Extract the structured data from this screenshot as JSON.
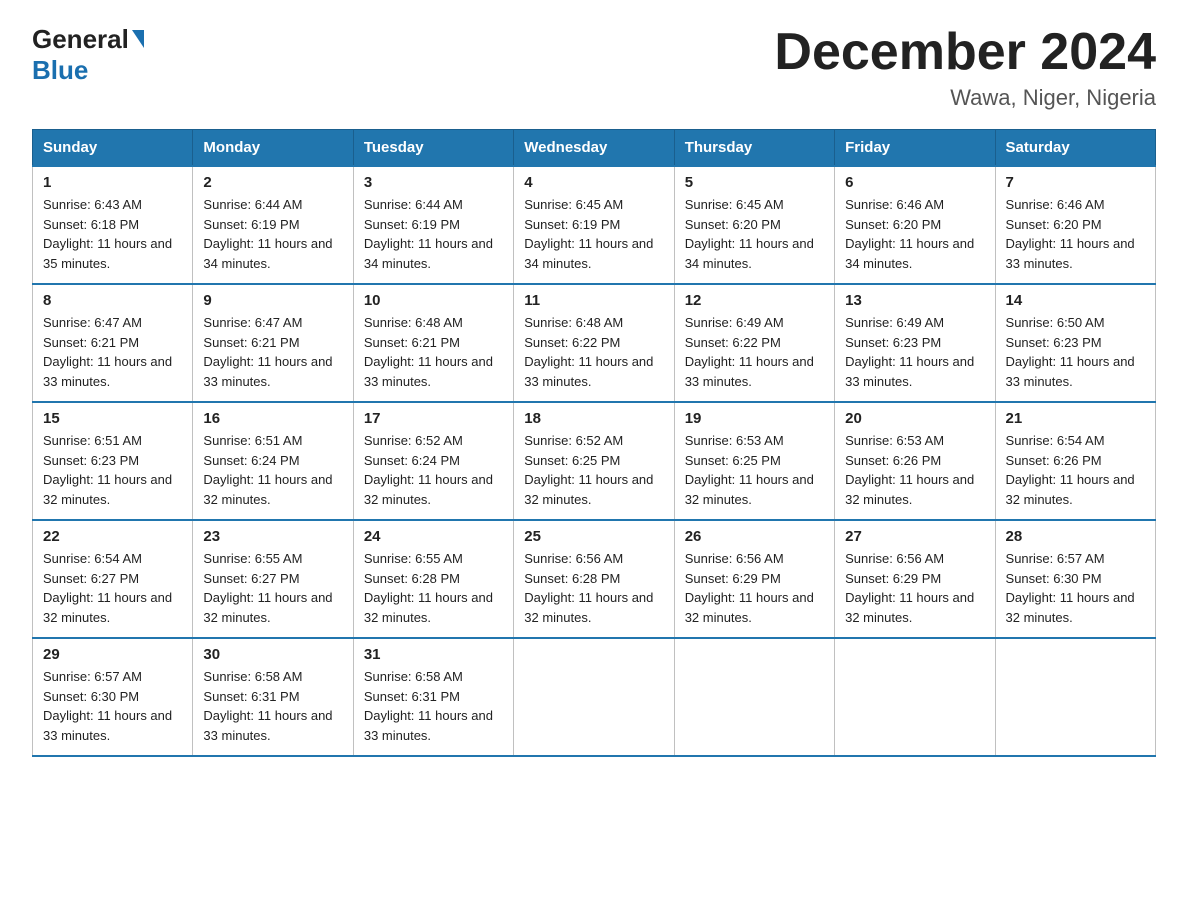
{
  "logo": {
    "general": "General",
    "blue": "Blue"
  },
  "header": {
    "title": "December 2024",
    "subtitle": "Wawa, Niger, Nigeria"
  },
  "days_of_week": [
    "Sunday",
    "Monday",
    "Tuesday",
    "Wednesday",
    "Thursday",
    "Friday",
    "Saturday"
  ],
  "weeks": [
    [
      {
        "day": "1",
        "sunrise": "6:43 AM",
        "sunset": "6:18 PM",
        "daylight": "11 hours and 35 minutes."
      },
      {
        "day": "2",
        "sunrise": "6:44 AM",
        "sunset": "6:19 PM",
        "daylight": "11 hours and 34 minutes."
      },
      {
        "day": "3",
        "sunrise": "6:44 AM",
        "sunset": "6:19 PM",
        "daylight": "11 hours and 34 minutes."
      },
      {
        "day": "4",
        "sunrise": "6:45 AM",
        "sunset": "6:19 PM",
        "daylight": "11 hours and 34 minutes."
      },
      {
        "day": "5",
        "sunrise": "6:45 AM",
        "sunset": "6:20 PM",
        "daylight": "11 hours and 34 minutes."
      },
      {
        "day": "6",
        "sunrise": "6:46 AM",
        "sunset": "6:20 PM",
        "daylight": "11 hours and 34 minutes."
      },
      {
        "day": "7",
        "sunrise": "6:46 AM",
        "sunset": "6:20 PM",
        "daylight": "11 hours and 33 minutes."
      }
    ],
    [
      {
        "day": "8",
        "sunrise": "6:47 AM",
        "sunset": "6:21 PM",
        "daylight": "11 hours and 33 minutes."
      },
      {
        "day": "9",
        "sunrise": "6:47 AM",
        "sunset": "6:21 PM",
        "daylight": "11 hours and 33 minutes."
      },
      {
        "day": "10",
        "sunrise": "6:48 AM",
        "sunset": "6:21 PM",
        "daylight": "11 hours and 33 minutes."
      },
      {
        "day": "11",
        "sunrise": "6:48 AM",
        "sunset": "6:22 PM",
        "daylight": "11 hours and 33 minutes."
      },
      {
        "day": "12",
        "sunrise": "6:49 AM",
        "sunset": "6:22 PM",
        "daylight": "11 hours and 33 minutes."
      },
      {
        "day": "13",
        "sunrise": "6:49 AM",
        "sunset": "6:23 PM",
        "daylight": "11 hours and 33 minutes."
      },
      {
        "day": "14",
        "sunrise": "6:50 AM",
        "sunset": "6:23 PM",
        "daylight": "11 hours and 33 minutes."
      }
    ],
    [
      {
        "day": "15",
        "sunrise": "6:51 AM",
        "sunset": "6:23 PM",
        "daylight": "11 hours and 32 minutes."
      },
      {
        "day": "16",
        "sunrise": "6:51 AM",
        "sunset": "6:24 PM",
        "daylight": "11 hours and 32 minutes."
      },
      {
        "day": "17",
        "sunrise": "6:52 AM",
        "sunset": "6:24 PM",
        "daylight": "11 hours and 32 minutes."
      },
      {
        "day": "18",
        "sunrise": "6:52 AM",
        "sunset": "6:25 PM",
        "daylight": "11 hours and 32 minutes."
      },
      {
        "day": "19",
        "sunrise": "6:53 AM",
        "sunset": "6:25 PM",
        "daylight": "11 hours and 32 minutes."
      },
      {
        "day": "20",
        "sunrise": "6:53 AM",
        "sunset": "6:26 PM",
        "daylight": "11 hours and 32 minutes."
      },
      {
        "day": "21",
        "sunrise": "6:54 AM",
        "sunset": "6:26 PM",
        "daylight": "11 hours and 32 minutes."
      }
    ],
    [
      {
        "day": "22",
        "sunrise": "6:54 AM",
        "sunset": "6:27 PM",
        "daylight": "11 hours and 32 minutes."
      },
      {
        "day": "23",
        "sunrise": "6:55 AM",
        "sunset": "6:27 PM",
        "daylight": "11 hours and 32 minutes."
      },
      {
        "day": "24",
        "sunrise": "6:55 AM",
        "sunset": "6:28 PM",
        "daylight": "11 hours and 32 minutes."
      },
      {
        "day": "25",
        "sunrise": "6:56 AM",
        "sunset": "6:28 PM",
        "daylight": "11 hours and 32 minutes."
      },
      {
        "day": "26",
        "sunrise": "6:56 AM",
        "sunset": "6:29 PM",
        "daylight": "11 hours and 32 minutes."
      },
      {
        "day": "27",
        "sunrise": "6:56 AM",
        "sunset": "6:29 PM",
        "daylight": "11 hours and 32 minutes."
      },
      {
        "day": "28",
        "sunrise": "6:57 AM",
        "sunset": "6:30 PM",
        "daylight": "11 hours and 32 minutes."
      }
    ],
    [
      {
        "day": "29",
        "sunrise": "6:57 AM",
        "sunset": "6:30 PM",
        "daylight": "11 hours and 33 minutes."
      },
      {
        "day": "30",
        "sunrise": "6:58 AM",
        "sunset": "6:31 PM",
        "daylight": "11 hours and 33 minutes."
      },
      {
        "day": "31",
        "sunrise": "6:58 AM",
        "sunset": "6:31 PM",
        "daylight": "11 hours and 33 minutes."
      },
      null,
      null,
      null,
      null
    ]
  ]
}
